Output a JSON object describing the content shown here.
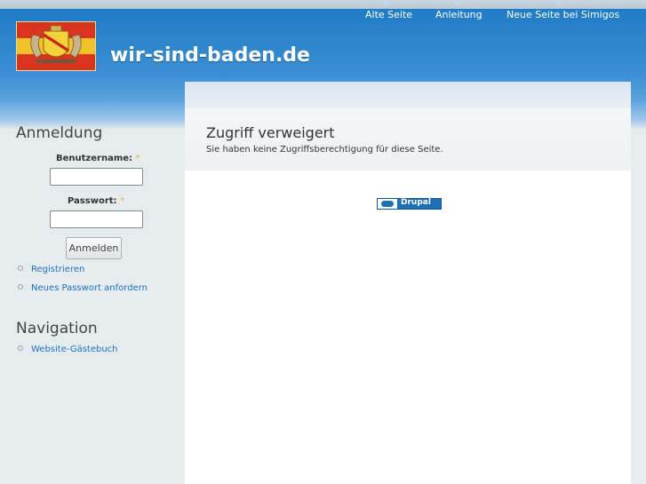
{
  "header": {
    "site_name": "wir-sind-baden.de",
    "logo_icon": "baden-flag-coat-of-arms-icon"
  },
  "primary_links": [
    {
      "label": "Alte Seite"
    },
    {
      "label": "Anleitung"
    },
    {
      "label": "Neue Seite bei Simigos"
    }
  ],
  "login": {
    "title": "Anmeldung",
    "username_label": "Benutzername:",
    "password_label": "Passwort:",
    "required_mark": "*",
    "username_value": "",
    "password_value": "",
    "submit_label": "Anmelden",
    "links": [
      {
        "label": "Registrieren"
      },
      {
        "label": "Neues Passwort anfordern"
      }
    ]
  },
  "navigation": {
    "title": "Navigation",
    "items": [
      {
        "label": "Website-Gästebuch"
      }
    ]
  },
  "main": {
    "title": "Zugriff verweigert",
    "message": "Sie haben keine Zugriffsberechtigung für diese Seite."
  },
  "footer": {
    "badge_label": "Drupal"
  },
  "colors": {
    "header_blue": "#1f7cc6",
    "link_blue": "#1b72bf",
    "required": "#f5a623"
  }
}
